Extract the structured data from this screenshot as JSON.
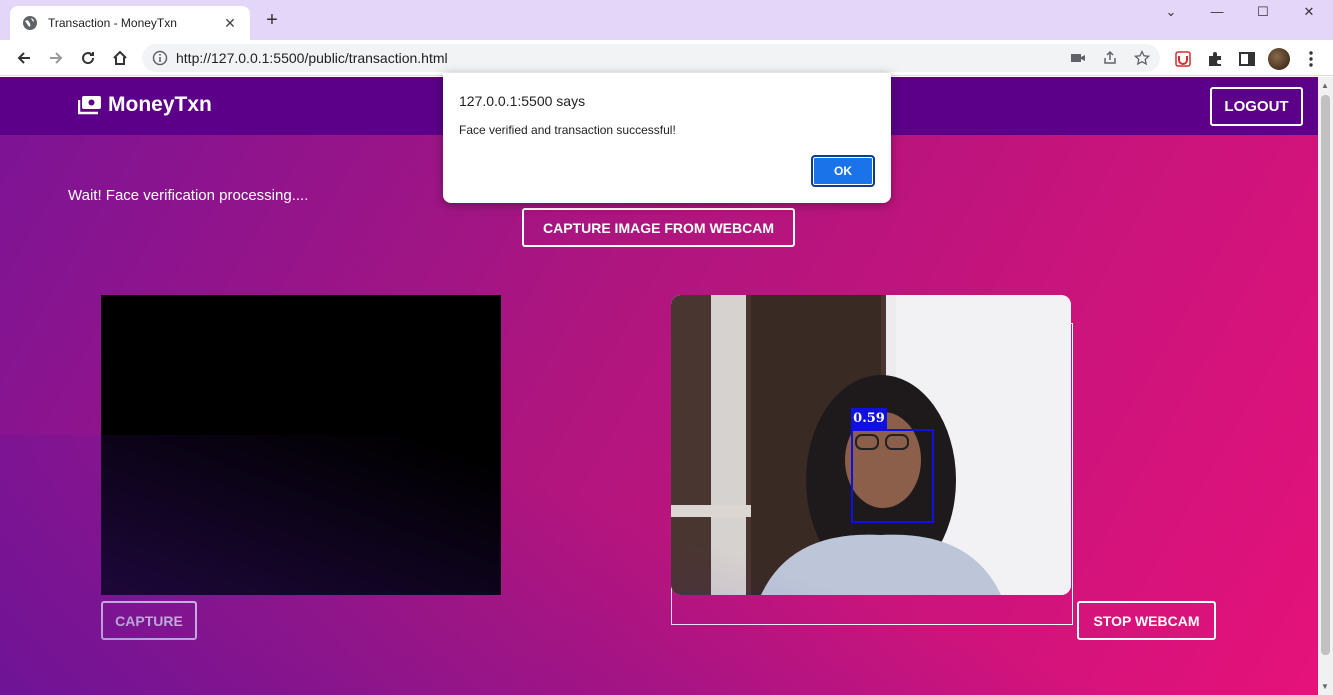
{
  "browser": {
    "tab_title": "Transaction - MoneyTxn",
    "tab_close": "✕",
    "new_tab": "+",
    "url": "http://127.0.0.1:5500/public/transaction.html",
    "window_controls": {
      "dropdown": "⌄",
      "minimize": "—",
      "maximize": "☐",
      "close": "✕"
    }
  },
  "navbar": {
    "brand": "MoneyTxn",
    "logout_label": "LOGOUT"
  },
  "main": {
    "status_text": "Wait! Face verification processing....",
    "capture_webcam_label": "CAPTURE IMAGE FROM WEBCAM",
    "capture_label": "CAPTURE",
    "stop_webcam_label": "STOP WEBCAM",
    "face_score": "0.59"
  },
  "dialog": {
    "origin": "127.0.0.1:5500 says",
    "message": "Face verified and transaction successful!",
    "ok_label": "OK"
  },
  "colors": {
    "navbar": "#5c0089",
    "gradient_start": "#7a1496",
    "gradient_end": "#e6127a",
    "face_box": "#1010e0",
    "dialog_button": "#1a73e8"
  }
}
